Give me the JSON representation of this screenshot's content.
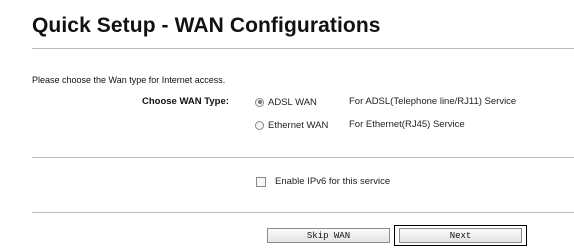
{
  "page": {
    "title": "Quick Setup - WAN Configurations"
  },
  "form": {
    "instructions": "Please choose the Wan type for Internet access.",
    "wan_type_label": "Choose WAN Type:",
    "wan_options": [
      {
        "label": "ADSL WAN",
        "description": "For ADSL(Telephone line/RJ11) Service",
        "selected": true
      },
      {
        "label": "Ethernet WAN",
        "description": "For Ethernet(RJ45) Service",
        "selected": false
      }
    ],
    "ipv6": {
      "label": "Enable IPv6 for this service",
      "checked": false
    }
  },
  "buttons": {
    "skip_label": "Skip WAN",
    "next_label": "Next"
  },
  "colors": {
    "divider": "#bdbdbd",
    "button_border": "#8c8c8c",
    "focus_border": "#000000"
  }
}
